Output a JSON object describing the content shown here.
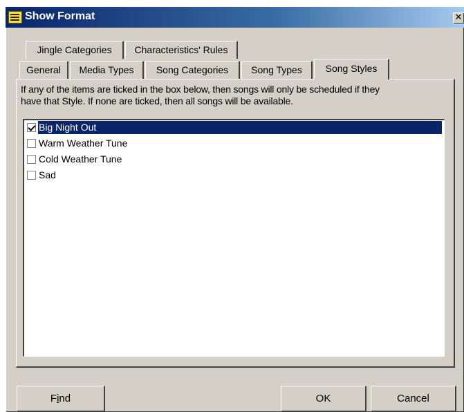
{
  "window": {
    "title": "Show Format",
    "close_glyph": "✕"
  },
  "tabs": {
    "row_back": [
      {
        "label": "Jingle Categories"
      },
      {
        "label": "Characteristics' Rules"
      }
    ],
    "row_front": [
      {
        "label": "General"
      },
      {
        "label": "Media Types"
      },
      {
        "label": "Song Categories"
      },
      {
        "label": "Song Types"
      },
      {
        "label": "Song Styles",
        "active": true
      }
    ]
  },
  "panel": {
    "description_line1": "If any of the items are ticked in the box below, then songs will only be scheduled if they",
    "description_line2": "have that Style. If none are ticked, then all songs will be available."
  },
  "styles_list": [
    {
      "label": "Big Night Out",
      "checked": true,
      "selected": true
    },
    {
      "label": "Warm Weather Tune",
      "checked": false,
      "selected": false
    },
    {
      "label": "Cold Weather Tune",
      "checked": false,
      "selected": false
    },
    {
      "label": "Sad",
      "checked": false,
      "selected": false
    }
  ],
  "buttons": {
    "find": {
      "prefix": "F",
      "underlined": "i",
      "suffix": "nd"
    },
    "ok": "OK",
    "cancel": "Cancel"
  },
  "colors": {
    "selection": "#0a246a",
    "face": "#d4d0c8"
  }
}
